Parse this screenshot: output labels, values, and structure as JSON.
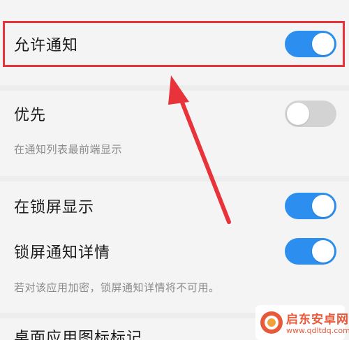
{
  "settings": {
    "allow_notifications": {
      "label": "允许通知",
      "enabled": true
    },
    "priority": {
      "label": "优先",
      "enabled": false,
      "hint": "在通知列表最前端显示"
    },
    "show_on_lock_screen": {
      "label": "在锁屏显示",
      "enabled": true
    },
    "lock_screen_details": {
      "label": "锁屏通知详情",
      "enabled": true,
      "hint": "若对该应用加密，锁屏通知详情将不可用。"
    },
    "next_item": {
      "label": "桌面应用图标标记"
    }
  },
  "colors": {
    "toggle_on": "#2c8ff0",
    "toggle_off": "#d3d3d3",
    "highlight": "#e8333a"
  },
  "watermark": {
    "title": "启东安卓网",
    "url": "www.qdltdq.com"
  }
}
